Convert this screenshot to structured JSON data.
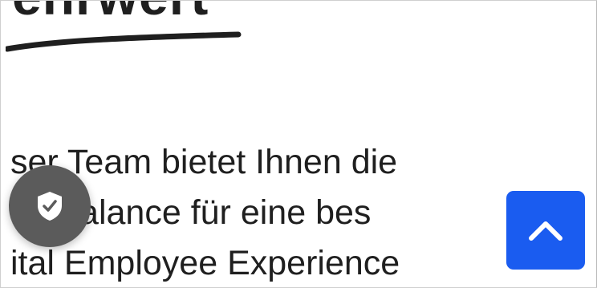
{
  "heading": {
    "fragment": "ehrwert"
  },
  "body": {
    "lines": [
      "ser Team bietet Ihnen die",
      "ke Balance für eine bes",
      "ital Employee Experience"
    ]
  },
  "buttons": {
    "privacy_icon": "shield-check-icon",
    "scroll_top_icon": "chevron-up-icon"
  },
  "colors": {
    "text": "#1f1f1f",
    "privacy_button": "#5b5b5b",
    "scroll_top_button": "#1a5cf0"
  }
}
